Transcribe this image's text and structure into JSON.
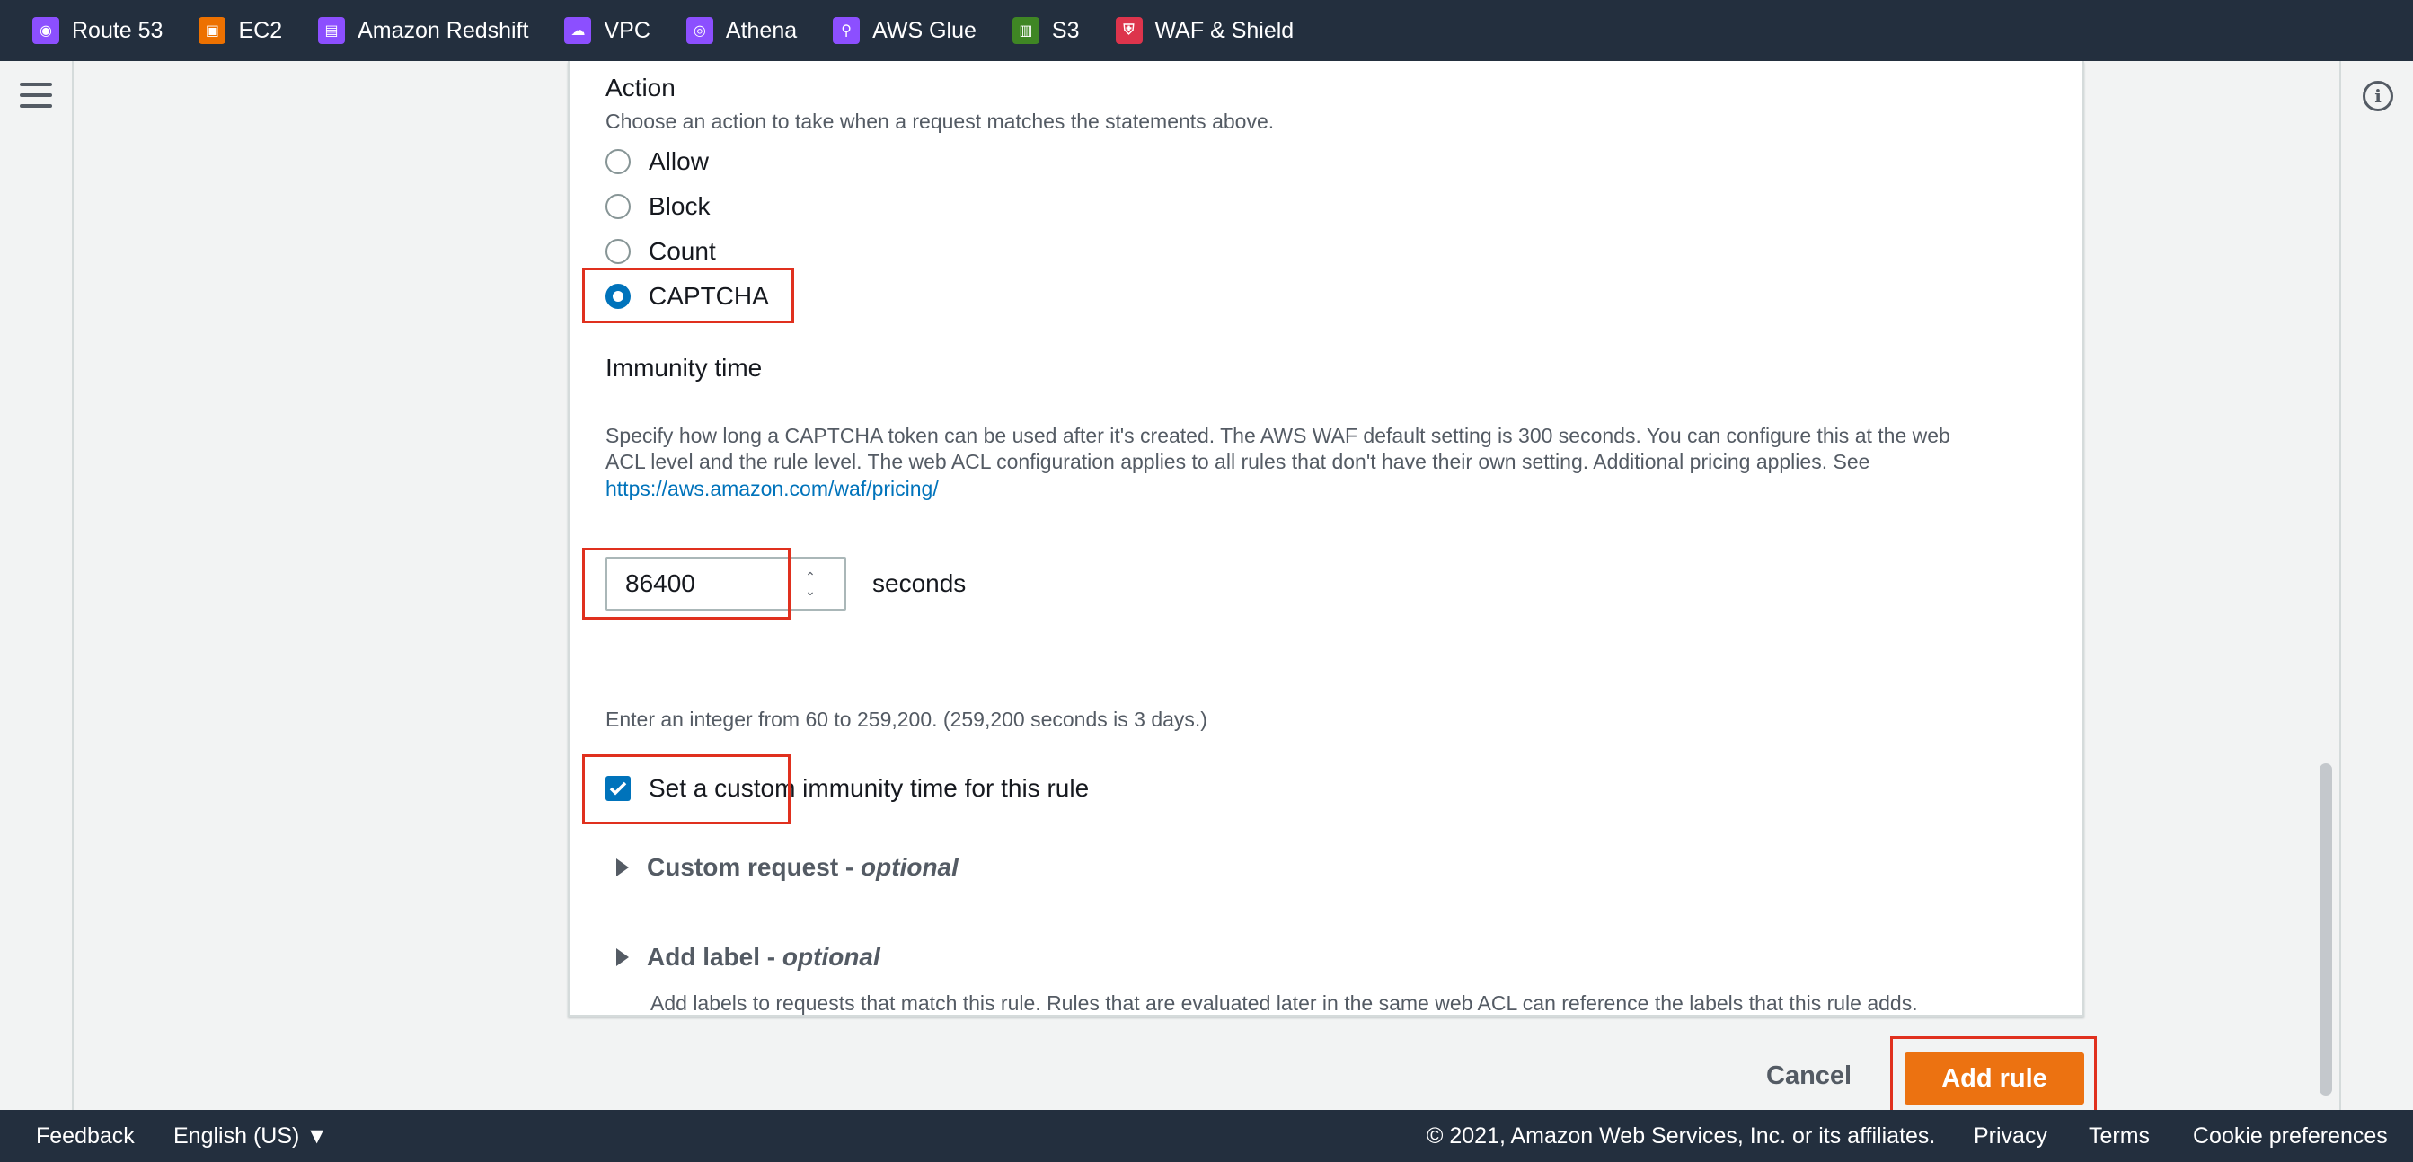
{
  "favorites": [
    {
      "label": "Route 53",
      "icon": "route53-icon",
      "color": "#8c4fff"
    },
    {
      "label": "EC2",
      "icon": "ec2-icon",
      "color": "#ed7100"
    },
    {
      "label": "Amazon Redshift",
      "icon": "redshift-icon",
      "color": "#8c4fff"
    },
    {
      "label": "VPC",
      "icon": "vpc-icon",
      "color": "#8c4fff"
    },
    {
      "label": "Athena",
      "icon": "athena-icon",
      "color": "#8c4fff"
    },
    {
      "label": "AWS Glue",
      "icon": "glue-icon",
      "color": "#8c4fff"
    },
    {
      "label": "S3",
      "icon": "s3-icon",
      "color": "#3f8624"
    },
    {
      "label": "WAF & Shield",
      "icon": "waf-icon",
      "color": "#dd344c"
    }
  ],
  "action": {
    "title": "Action",
    "description": "Choose an action to take when a request matches the statements above.",
    "options": [
      "Allow",
      "Block",
      "Count",
      "CAPTCHA"
    ],
    "selected": "CAPTCHA"
  },
  "immunity": {
    "title": "Immunity time",
    "description_line1": "Specify how long a CAPTCHA token can be used after it's created. The AWS WAF default setting is 300 seconds. You can configure this at the web",
    "description_line2": "ACL level and the rule level. The web ACL configuration applies to all rules that don't have their own setting. Additional pricing applies. See",
    "link": "https://aws.amazon.com/waf/pricing/",
    "value": "86400",
    "unit": "seconds",
    "hint": "Enter an integer from 60 to 259,200. (259,200 seconds is 3 days.)",
    "custom_checkbox_label": "Set a custom immunity time for this rule",
    "custom_checked": true
  },
  "custom_request": {
    "title": "Custom request - ",
    "optional": "optional"
  },
  "add_label": {
    "title": "Add label - ",
    "optional": "optional",
    "description": "Add labels to requests that match this rule. Rules that are evaluated later in the same web ACL can reference the labels that this rule adds."
  },
  "buttons": {
    "cancel": "Cancel",
    "add_rule": "Add rule"
  },
  "footer": {
    "feedback": "Feedback",
    "language": "English (US) ▼",
    "copyright": "© 2021, Amazon Web Services, Inc. or its affiliates.",
    "privacy": "Privacy",
    "terms": "Terms",
    "cookies": "Cookie preferences"
  },
  "colors": {
    "accent": "#0073bb",
    "primary_button": "#ec7211",
    "highlight": "#e0301e",
    "nav": "#232f3e"
  }
}
